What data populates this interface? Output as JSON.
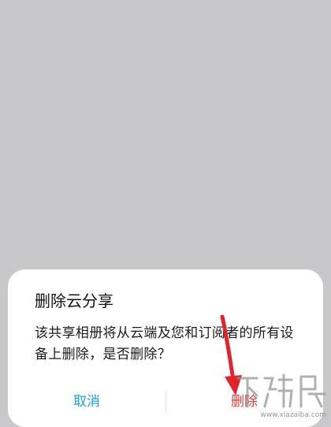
{
  "dialog": {
    "title": "删除云分享",
    "message": "该共享相册将从云端及您和订阅者的所有设备上删除，是否删除？",
    "cancel_label": "取消",
    "delete_label": "删除"
  },
  "watermark": {
    "logo_text": "下载吧",
    "url": "www.xiazaiba.com"
  },
  "colors": {
    "cancel": "#1aa3d6",
    "delete": "#e13b3b",
    "annotation_arrow": "#e0242b"
  },
  "icons": [
    "annotation-arrow-icon"
  ]
}
